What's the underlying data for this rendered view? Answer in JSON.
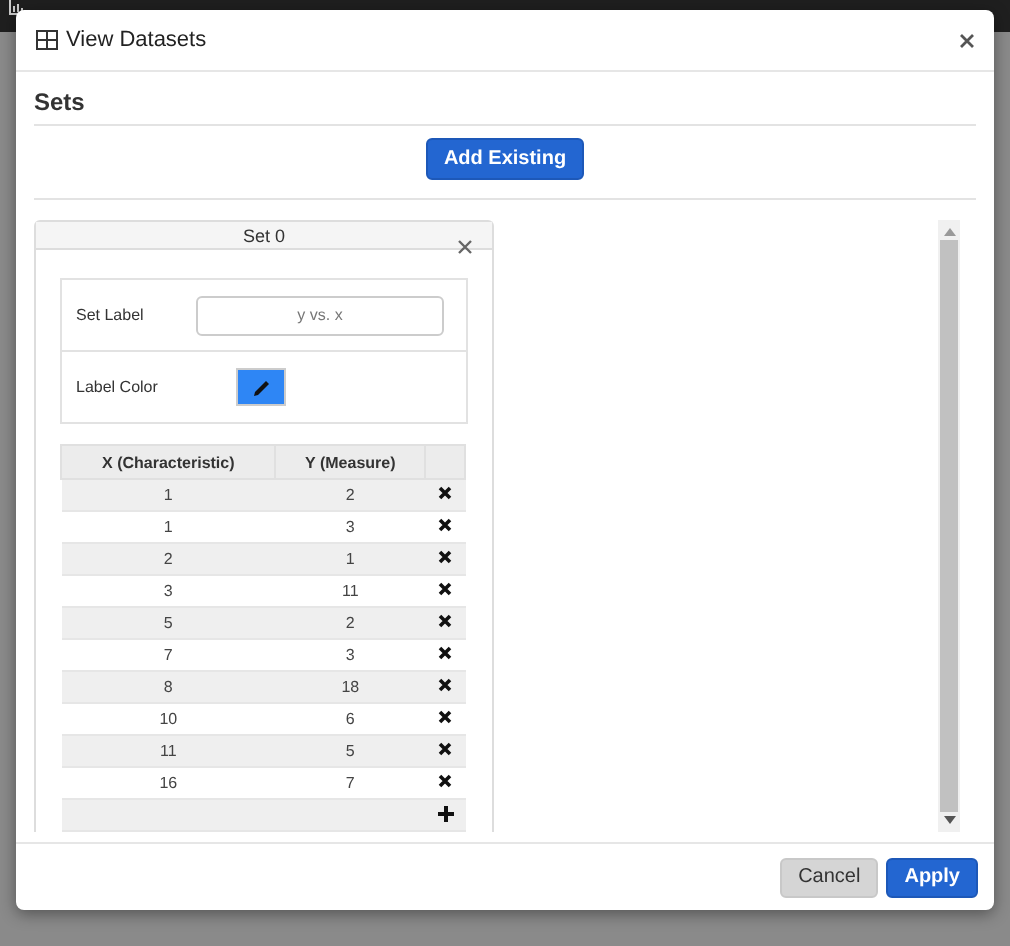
{
  "dialog": {
    "title": "View Datasets",
    "section_title": "Sets",
    "add_button": "Add Existing",
    "set": {
      "title": "Set 0",
      "label_field": {
        "label": "Set Label",
        "placeholder": "y vs. x"
      },
      "color_field": {
        "label": "Label Color",
        "color": "#2e86f5"
      },
      "table": {
        "columns": [
          "X (Characteristic)",
          "Y (Measure)"
        ],
        "rows": [
          [
            "1",
            "2"
          ],
          [
            "1",
            "3"
          ],
          [
            "2",
            "1"
          ],
          [
            "3",
            "11"
          ],
          [
            "5",
            "2"
          ],
          [
            "7",
            "3"
          ],
          [
            "8",
            "18"
          ],
          [
            "10",
            "6"
          ],
          [
            "11",
            "5"
          ],
          [
            "16",
            "7"
          ]
        ]
      }
    },
    "buttons": [
      {
        "label": "Cancel",
        "kind": "secondary"
      },
      {
        "label": "Apply",
        "kind": "primary"
      }
    ]
  }
}
